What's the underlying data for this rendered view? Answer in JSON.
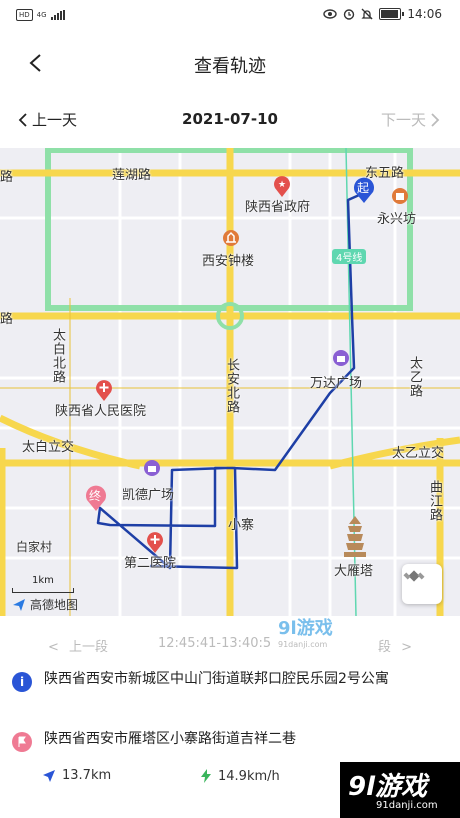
{
  "status_bar": {
    "hd": "HD",
    "network": "4G",
    "time": "14:06",
    "icons": [
      "eye-icon",
      "alarm-icon",
      "mute-icon",
      "battery-icon"
    ]
  },
  "header": {
    "title": "查看轨迹",
    "back_icon": "chevron-left-icon"
  },
  "date_nav": {
    "prev_label": "上一天",
    "date": "2021-07-10",
    "next_label": "下一天"
  },
  "map": {
    "roads": {
      "lianhu": "莲湖路",
      "dongwu": "东五路",
      "taibai_north": "太白北路",
      "changan_north": "长安北路",
      "taiyi_road": "太乙路",
      "taibai_overpass": "太白立交",
      "taiyi_overpass": "太乙立交",
      "qujiang": "曲江路",
      "xiaozhai": "小寨",
      "baijiacun": "白家村",
      "line4": "4号线",
      "road_left": "路"
    },
    "pois": {
      "provincial_gov": "陕西省政府",
      "bell_tower": "西安钟楼",
      "yongxing": "永兴坊",
      "wanda": "万达广场",
      "people_hospital": "陕西省人民医院",
      "kaide": "凯德广场",
      "second_hospital": "第二医院",
      "dayan_pagoda": "大雁塔",
      "start": "起",
      "end": "终"
    },
    "scale": "1km",
    "logo": "高德地图",
    "colors": {
      "route": "#1e3fa6",
      "main_road": "#f7d74d",
      "park": "#8fe0a8",
      "hospital": "#e3504c",
      "mall": "#8a5fd3"
    }
  },
  "segment": {
    "prev_label": "上一段",
    "time_range": "12:45:41-13:40:5",
    "next_label": "段"
  },
  "addresses": {
    "start": "陕西省西安市新城区中山门街道联邦口腔民乐园2号公寓",
    "end": "陕西省西安市雁塔区小寨路街道吉祥二巷"
  },
  "stats": {
    "distance": "13.7km",
    "speed": "14.9km/h"
  },
  "watermark": {
    "center_main": "9l游戏",
    "center_sub": "91danji.com",
    "corner_main": "9l游戏",
    "corner_sub": "91danji.com"
  }
}
